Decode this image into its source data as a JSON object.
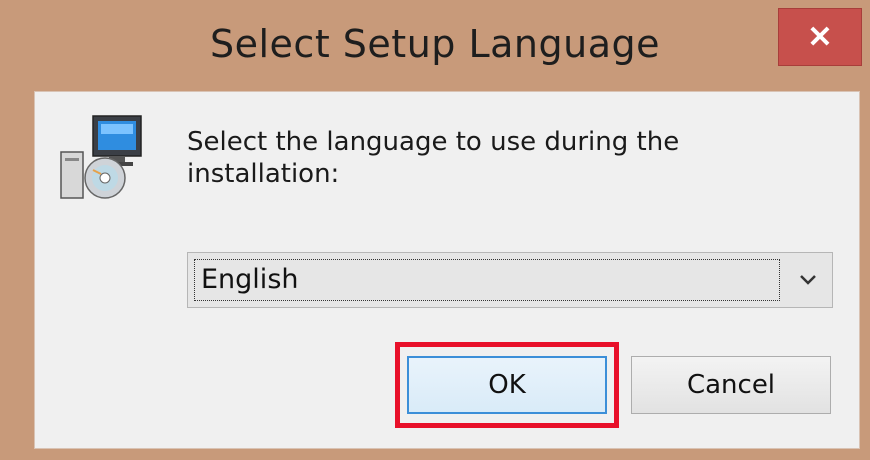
{
  "window": {
    "title": "Select Setup Language",
    "close_label": "✕",
    "accent_color": "#c89a7a",
    "close_color": "#c7504c"
  },
  "content": {
    "icon": "setup-installer-icon",
    "prompt": "Select the language to use during the installation:",
    "language_select": {
      "value": "English",
      "arrow_icon": "chevron-down-icon"
    }
  },
  "buttons": {
    "ok_label": "OK",
    "cancel_label": "Cancel",
    "highlight_color": "#e8102a"
  }
}
